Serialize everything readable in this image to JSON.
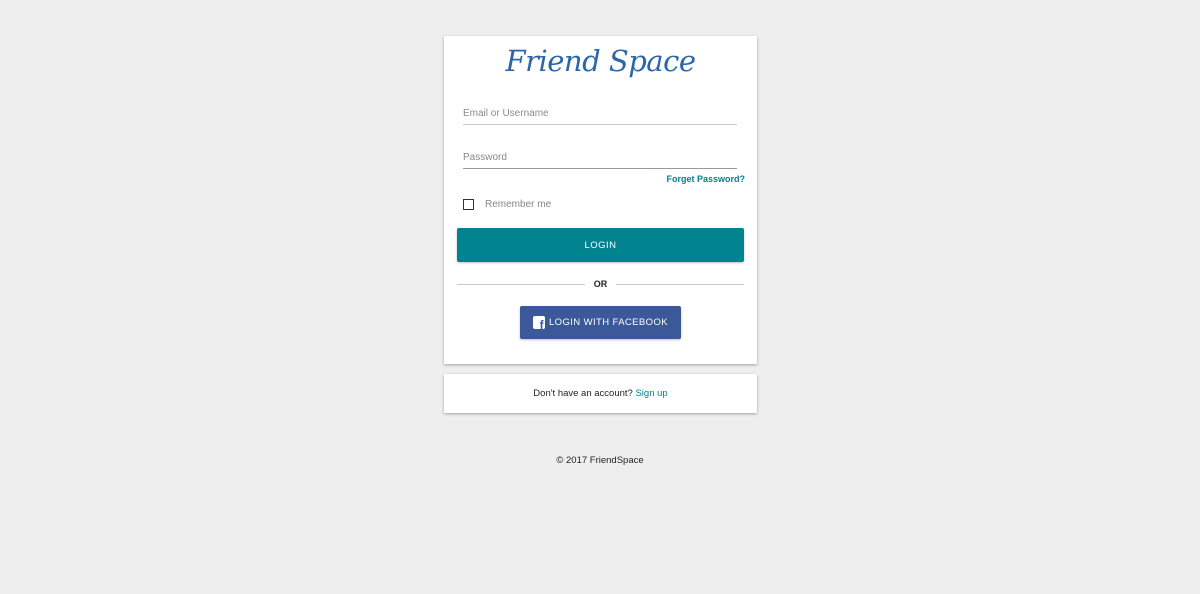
{
  "app": {
    "logo_text": "Friend Space"
  },
  "login_form": {
    "email_placeholder": "Email or Username",
    "password_placeholder": "Password",
    "forgot_password_label": "Forget Password?",
    "remember_me_label": "Remember me",
    "remember_me_checked": false,
    "login_button_label": "LOGIN",
    "divider_text": "OR",
    "facebook_button_label": "LOGIN WITH FACEBOOK"
  },
  "signup": {
    "prompt_text": "Don't have an account?",
    "link_label": "Sign up"
  },
  "footer": {
    "copyright": "© 2017 FriendSpace"
  },
  "colors": {
    "background": "#eeeeee",
    "logo": "#2a66a8",
    "primary": "#00838f",
    "facebook": "#3b5998",
    "link": "#00858f"
  },
  "icons": {
    "facebook": "facebook-icon"
  }
}
